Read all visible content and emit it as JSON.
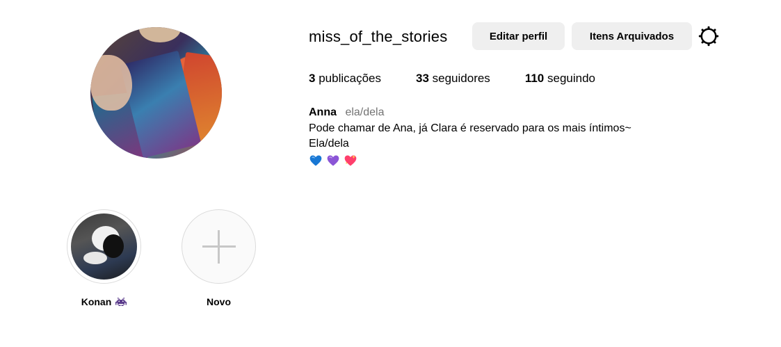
{
  "profile": {
    "username": "miss_of_the_stories",
    "avatar_icon": "profile-avatar",
    "edit_label": "Editar perfil",
    "archive_label": "Itens Arquivados",
    "settings_icon": "gear-icon"
  },
  "stats": [
    {
      "count": "3",
      "label": "publicações"
    },
    {
      "count": "33",
      "label": "seguidores"
    },
    {
      "count": "110",
      "label": "seguindo"
    }
  ],
  "bio": {
    "name": "Anna",
    "pronouns": "ela/dela",
    "line1": "Pode chamar de Ana, já Clara é reservado para os mais íntimos~",
    "line2": "Ela/dela",
    "hearts": [
      {
        "icon": "blue-heart-icon",
        "color": "#1877d4"
      },
      {
        "icon": "purple-heart-icon",
        "color": "#8b55d6"
      },
      {
        "icon": "sparkling-heart-icon",
        "color": "#ff3f6c"
      }
    ]
  },
  "highlights": [
    {
      "label": "Konan",
      "icon": "alien-monster-icon",
      "icon_color": "#5b3c8c"
    },
    {
      "label": "Novo",
      "icon": "plus-icon"
    }
  ]
}
